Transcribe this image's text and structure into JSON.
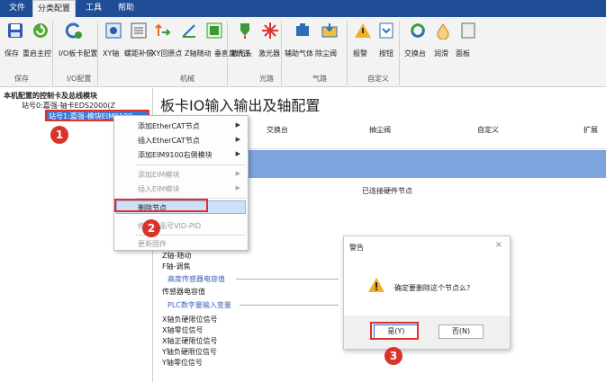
{
  "menubar": {
    "tabs": [
      "文件",
      "分类配置",
      "工具",
      "帮助"
    ]
  },
  "ribbon": {
    "buttons": [
      "保存",
      "重启主控",
      "I/O板卡配置",
      "XY轴",
      "螺距补偿",
      "XY回原点",
      "Z轴随动",
      "垂直度矫正",
      "激光头",
      "激光器",
      "辅助气体",
      "除尘阀",
      "报警",
      "按钮",
      "交换台",
      "润滑",
      "面板"
    ],
    "groups": [
      "保存",
      "I/O配置",
      "机械",
      "光路",
      "气路",
      "自定义"
    ]
  },
  "tree": {
    "root": "本机配置的控制卡及总线模块",
    "node0": "站号0:嘉强-轴卡EDS2000(Z",
    "node1": "站号1:嘉强-模块EIM9100"
  },
  "main": {
    "title": "板卡IO输入输出及轴配置",
    "strip_items": [
      "交换台",
      "抽尘阀",
      "自定义",
      "扩展"
    ],
    "connected": "已连接硬件节点",
    "list_a": [
      "Z轴-随动",
      "F轴-调焦"
    ],
    "section1": "高度传感器电容值",
    "cap": "传感器电容值",
    "section2": "PLC数字量输入变量",
    "list_b": [
      "X轴负硬限位信号",
      "X轴零位信号",
      "X轴正硬限位信号",
      "Y轴负硬限位信号",
      "Y轴零位信号"
    ]
  },
  "context_menu": {
    "items": [
      "添加EtherCAT节点",
      "插入EtherCAT节点",
      "添加EIM9100右侧模块",
      "添加EIM模块",
      "插入EIM模块",
      "删除节点",
      "修改产品号VID-PID",
      "更新固件"
    ]
  },
  "dialog": {
    "title": "警告",
    "message": "确定要删除这个节点么?",
    "yes": "是(Y)",
    "no": "否(N)"
  },
  "badges": [
    "1",
    "2",
    "3"
  ],
  "colors": {
    "menubar": "#1f4e96",
    "blue_band": "#7da4dc",
    "highlight": "#e0302a"
  }
}
